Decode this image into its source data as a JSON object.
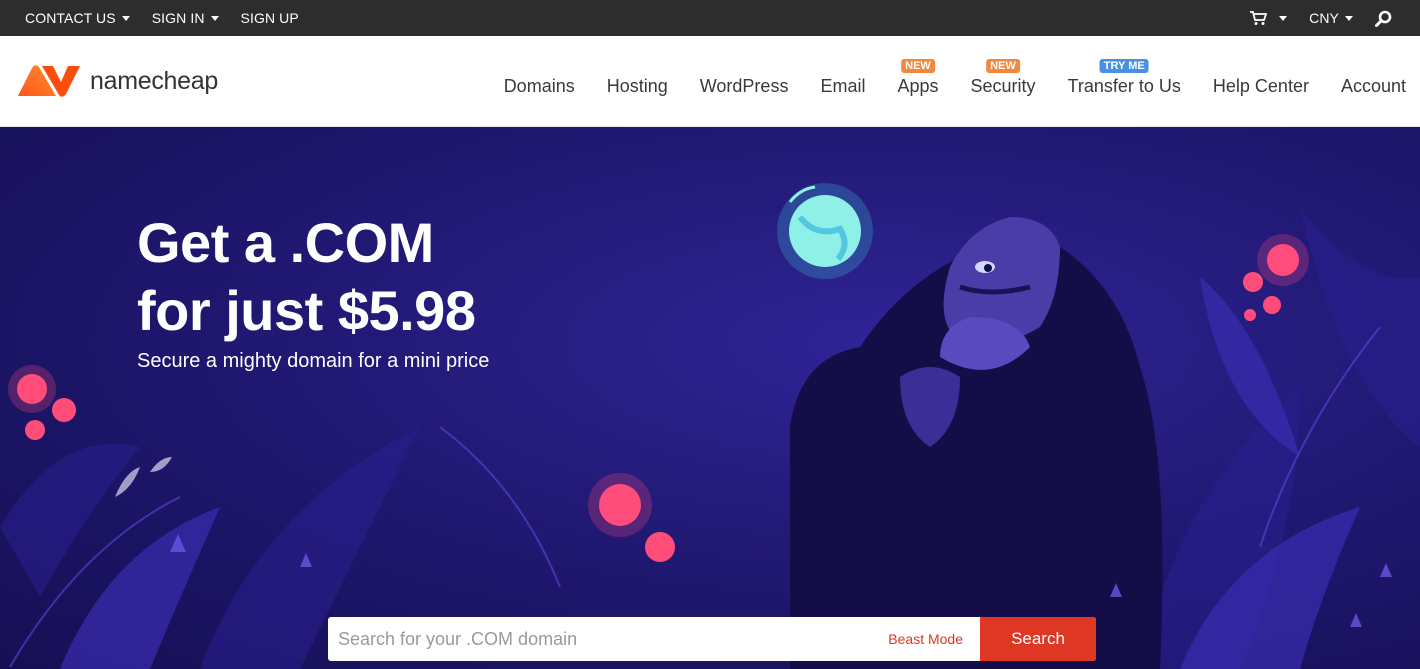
{
  "topbar": {
    "contact_us": "CONTACT US",
    "sign_in": "SIGN IN",
    "sign_up": "SIGN UP",
    "currency": "CNY"
  },
  "header": {
    "logo_text": "namecheap",
    "nav": [
      {
        "label": "Domains",
        "badge": ""
      },
      {
        "label": "Hosting",
        "badge": ""
      },
      {
        "label": "WordPress",
        "badge": ""
      },
      {
        "label": "Email",
        "badge": ""
      },
      {
        "label": "Apps",
        "badge": "NEW"
      },
      {
        "label": "Security",
        "badge": "NEW"
      },
      {
        "label": "Transfer to Us",
        "badge": "TRY ME"
      },
      {
        "label": "Help Center",
        "badge": ""
      },
      {
        "label": "Account",
        "badge": ""
      }
    ]
  },
  "hero": {
    "headline_line1": "Get a .COM",
    "headline_line2": "for just $5.98",
    "subline": "Secure a mighty domain for a mini price"
  },
  "search": {
    "placeholder": "Search for your .COM domain",
    "beast_mode": "Beast Mode",
    "button": "Search"
  },
  "colors": {
    "accent": "#de3723",
    "topbar_bg": "#2d2d2d",
    "hero_bg": "#1e1569",
    "badge_new": "#f0883e",
    "badge_tryme": "#4a90e2",
    "logo_orange": "#fd4c0b"
  }
}
